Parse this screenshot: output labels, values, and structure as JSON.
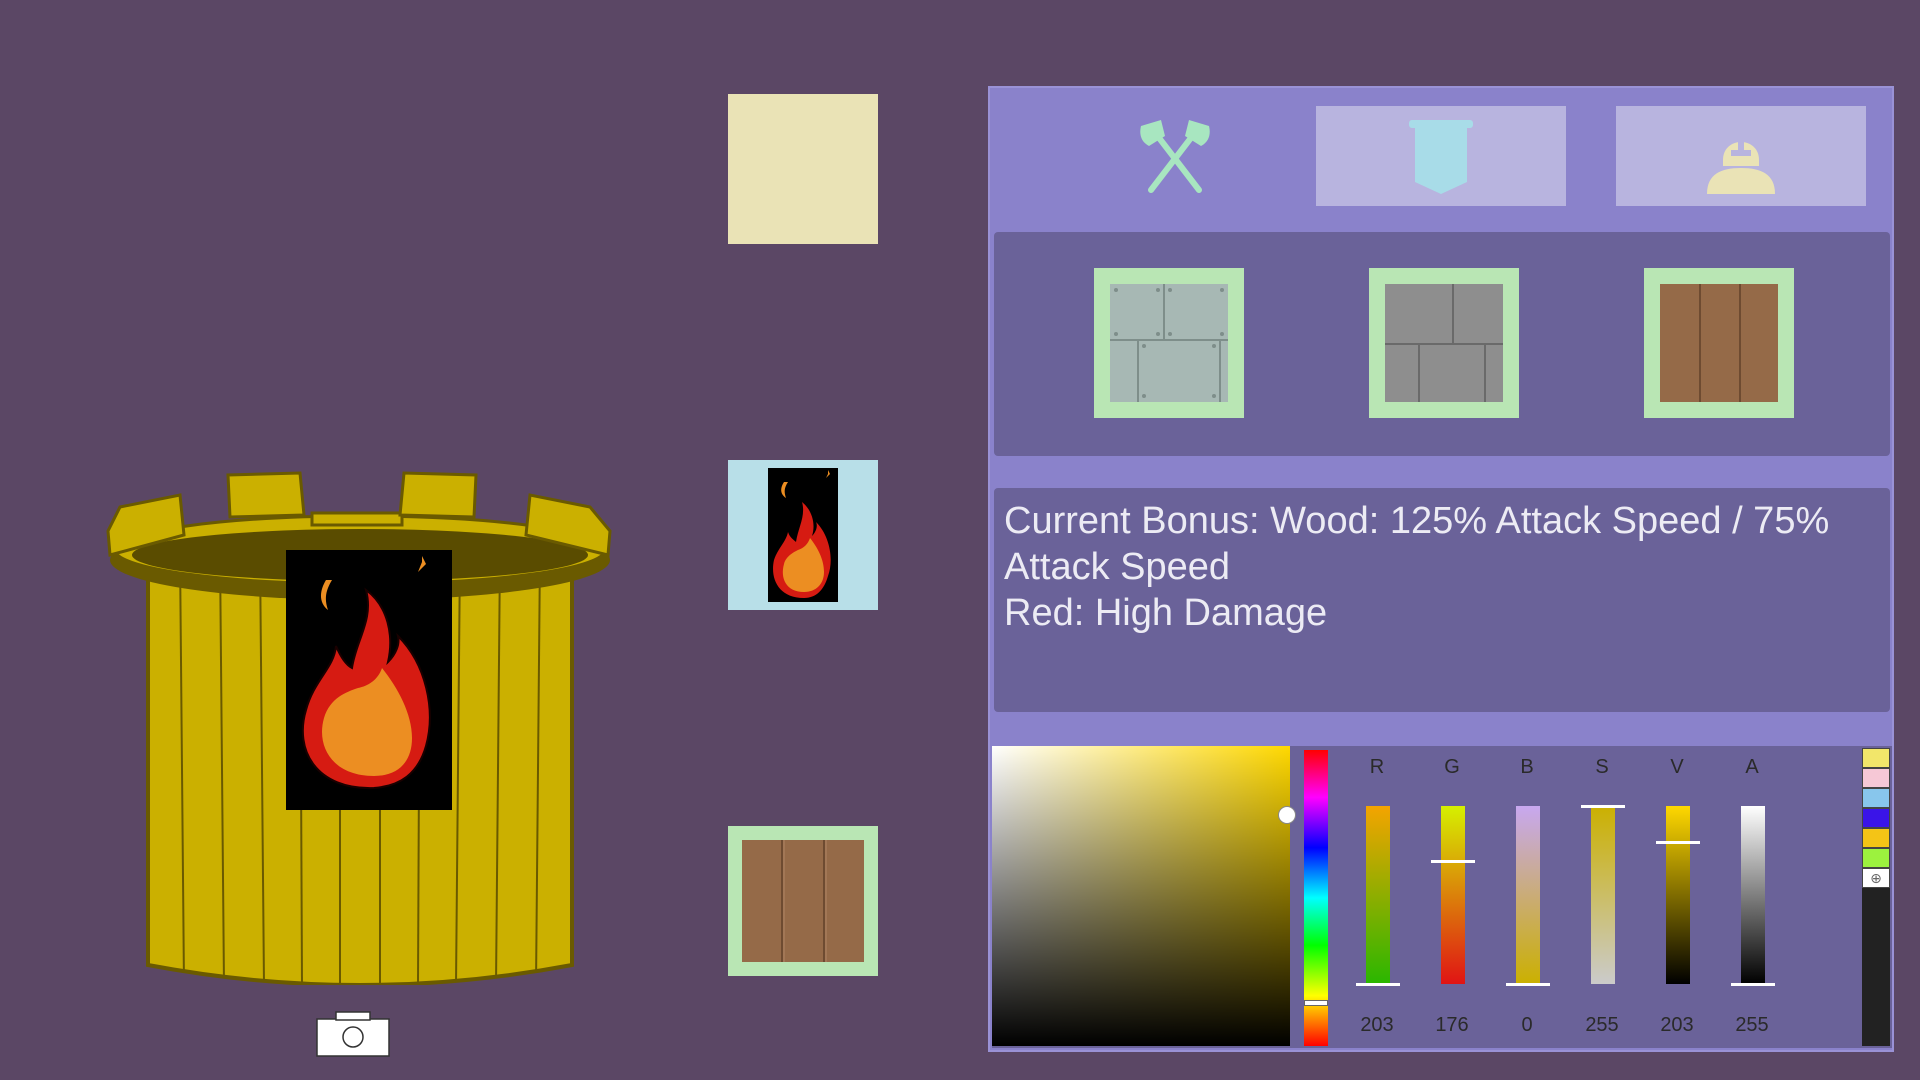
{
  "bonus": {
    "text": "Current Bonus: Wood: 125% Attack Speed / 75%\nAttack Speed\nRed: High Damage"
  },
  "tabs": [
    {
      "name": "weapons",
      "icon": "crossed-axes-icon"
    },
    {
      "name": "banner",
      "icon": "banner-icon"
    },
    {
      "name": "helmet",
      "icon": "knight-helmet-icon"
    }
  ],
  "materials": [
    {
      "name": "iron",
      "texture": "riveted-metal"
    },
    {
      "name": "stone",
      "texture": "stone-bricks"
    },
    {
      "name": "wood",
      "texture": "wood-planks",
      "selected": true
    }
  ],
  "preview": {
    "color": "#eae3b6",
    "banner_background": "#b8dfe8",
    "banner_icon": "flame-icon",
    "material": "wood"
  },
  "tower": {
    "color": "#cbb000",
    "banner_emblem": "flame-icon"
  },
  "color_picker": {
    "hue_color": "#ffd800",
    "channels": [
      {
        "label": "R",
        "value": "203",
        "level": 0.0
      },
      {
        "label": "G",
        "value": "176",
        "level": 0.69
      },
      {
        "label": "B",
        "value": "0",
        "level": 0.0
      },
      {
        "label": "S",
        "value": "255",
        "level": 1.0
      },
      {
        "label": "V",
        "value": "203",
        "level": 0.8
      },
      {
        "label": "A",
        "value": "255",
        "level": 0.0
      }
    ],
    "swatches": [
      "#f2e66a",
      "#f6c8d6",
      "#88c6ec",
      "#3a14e8",
      "#f4c416",
      "#9cf23e"
    ]
  },
  "colors": {
    "background": "#5b4765",
    "panel": "#8a82cb",
    "section": "#6a6299",
    "slot_frame": "#b9e6b4",
    "tab_inactive": "#b8b4df"
  }
}
